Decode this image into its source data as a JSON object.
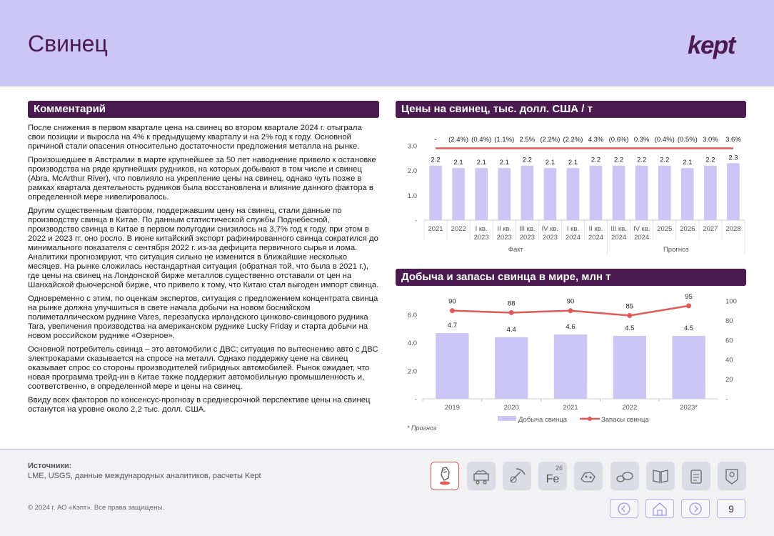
{
  "header": {
    "title": "Свинец",
    "logo": "kept"
  },
  "left": {
    "section_title": "Комментарий",
    "paragraphs": [
      "После снижения в первом квартале цена на свинец во втором квартале 2024 г. отыграла свои позиции и выросла на 4% к предыдущему кварталу и на 2% год к году. Основной причиной стали опасения относительно достаточности предложения металла на рынке.",
      "Произошедшее в Австралии в марте крупнейшее за 50 лет наводнение привело к остановке производства на ряде крупнейших рудников, на которых добывают в том числе и свинец (Abra, McArthur River), что повлияло на укрепление цены на свинец, однако чуть позже в рамках квартала деятельность рудников была восстановлена и влияние данного фактора в определенной мере нивелировалось.",
      "Другим существенным фактором, поддержавшим цену на свинец, стали данные по производству свинца в Китае. По данным статистической службы Поднебесной, производство свинца в Китае в первом полугодии снизилось на 3,7% год к году, при этом в 2022 и 2023 гг. оно росло. В июне китайский экспорт рафинированного свинца сократился до минимального показателя с сентября 2022 г. из-за дефицита первичного сырья и лома. Аналитики прогнозируют, что ситуация сильно не изменится в ближайшие несколько месяцев. На рынке сложилась нестандартная ситуация (обратная той, что была в 2021 г.), где цены на свинец на Лондонской бирже металлов существенно отставали от цен на Шанхайской фьючерсной бирже, что привело к тому, что Китаю стал выгоден импорт свинца.",
      "Одновременно с этим, по оценкам экспертов, ситуация с предложением концентрата свинца на рынке должна улучшиться в свете начала добычи на новом боснийском полиметаллическом руднике Vares, перезапуска ирландского цинково-свинцового рудника Tara, увеличения производства на американском руднике Lucky Friday и старта добычи на новом российском руднике «Озерное».",
      "Основной потребитель свинца – это автомобили с ДВС; ситуация по вытеснению авто с ДВС электрокарами сказывается на спросе на металл. Однако поддержку цене на свинец оказывает спрос со стороны производителей гибридных автомобилей. Рынок ожидает, что новая программа трейд-ин в Китае также поддержит автомобильную промышленность и, соответственно, в определенной мере и цены на свинец.",
      "Ввиду всех факторов по консенсус-прогнозу в среднесрочной перспективе цены на свинец останутся на уровне около 2,2 тыс. долл. США."
    ]
  },
  "chart_data": [
    {
      "type": "bar",
      "title": "Цены на свинец, тыс. долл. США / т",
      "categories": [
        [
          "2021"
        ],
        [
          "2022"
        ],
        [
          "I кв.",
          "2023"
        ],
        [
          "II кв.",
          "2023"
        ],
        [
          "III кв.",
          "2023"
        ],
        [
          "IV кв.",
          "2023"
        ],
        [
          "I кв.",
          "2024"
        ],
        [
          "II кв.",
          "2024"
        ],
        [
          "III кв.",
          "2024"
        ],
        [
          "IV кв.",
          "2024"
        ],
        [
          "2025"
        ],
        [
          "2026"
        ],
        [
          "2027"
        ],
        [
          "2028"
        ]
      ],
      "values": [
        2.2,
        2.1,
        2.1,
        2.1,
        2.2,
        2.1,
        2.1,
        2.2,
        2.2,
        2.2,
        2.2,
        2.1,
        2.2,
        2.3
      ],
      "value_labels": [
        "2.2",
        "2.1",
        "2.1",
        "2.1",
        "2.2",
        "2.1",
        "2.1",
        "2.2",
        "2.2",
        "2.2",
        "2.2",
        "2.1",
        "2.2",
        "2.3"
      ],
      "change_labels": [
        "-",
        "(2.4%)",
        "(0.4%)",
        "(1.1%)",
        "2.5%",
        "(2.2%)",
        "(2.2%)",
        "4.3%",
        "(0.6%)",
        "0.3%",
        "(0.4%)",
        "(0.5%)",
        "3.0%",
        "3.6%"
      ],
      "line_values": [
        2.9,
        2.9,
        2.9,
        2.9,
        2.9,
        2.9,
        2.9,
        2.9,
        2.9,
        2.9,
        2.9,
        2.9,
        2.9,
        2.9
      ],
      "yticks": [
        "-",
        "1.0",
        "2.0",
        "3.0"
      ],
      "ylim": [
        0,
        3.0
      ],
      "groups": [
        {
          "label": "Факт",
          "from": 0,
          "to": 7
        },
        {
          "label": "Прогноз",
          "from": 8,
          "to": 13
        }
      ],
      "colors": {
        "bar": "#cbc6f6",
        "line": "#e05a5a"
      }
    },
    {
      "type": "bar",
      "title": "Добыча и запасы свинца в мире, млн т",
      "categories": [
        "2019",
        "2020",
        "2021",
        "2022",
        "2023*"
      ],
      "series": [
        {
          "name": "Добыча свинца",
          "values": [
            4.7,
            4.4,
            4.6,
            4.5,
            4.5
          ],
          "labels": [
            "4.7",
            "4.4",
            "4.6",
            "4.5",
            "4.5"
          ],
          "axis": "left"
        },
        {
          "name": "Запасы свинца",
          "values": [
            90,
            88,
            90,
            85,
            95
          ],
          "labels": [
            "90",
            "88",
            "90",
            "85",
            "95"
          ],
          "axis": "right"
        }
      ],
      "yticks_left": [
        "-",
        "2.0",
        "4.0",
        "6.0"
      ],
      "ylim_left": [
        0,
        7.0
      ],
      "yticks_right": [
        "-",
        "20",
        "40",
        "60",
        "80",
        "100"
      ],
      "ylim_right": [
        0,
        100
      ],
      "legend": "bottom",
      "footnote": "* Прогноз",
      "colors": {
        "bar": "#cbc6f6",
        "line": "#e05a5a"
      }
    }
  ],
  "footer": {
    "sources_label": "Источники:",
    "sources_text": "LME, USGS, данные международных аналитиков, расчеты Kept",
    "copyright": "© 2024 г. АО «Кэпт». Все права защищены.",
    "page_number": "9",
    "fe_number": "26",
    "fe_symbol": "Fe"
  }
}
